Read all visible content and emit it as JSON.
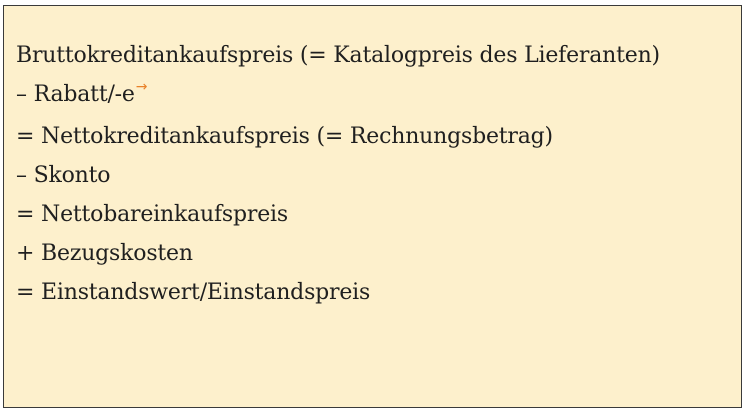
{
  "calculation": {
    "lines": [
      "Bruttokreditankaufspreis (= Katalogpreis des Lieferanten)",
      "– Rabatt/-e",
      "= Nettokreditankaufspreis (= Rechnungsbetrag)",
      "– Skonto",
      "= Nettobareinkaufspreis",
      "+ Bezugskosten",
      "= Einstandswert/Einstandspreis"
    ],
    "rabatt_marker": "→"
  },
  "colors": {
    "background": "#fdf0cc",
    "text": "#1f1f1f",
    "marker": "#e8822a"
  }
}
